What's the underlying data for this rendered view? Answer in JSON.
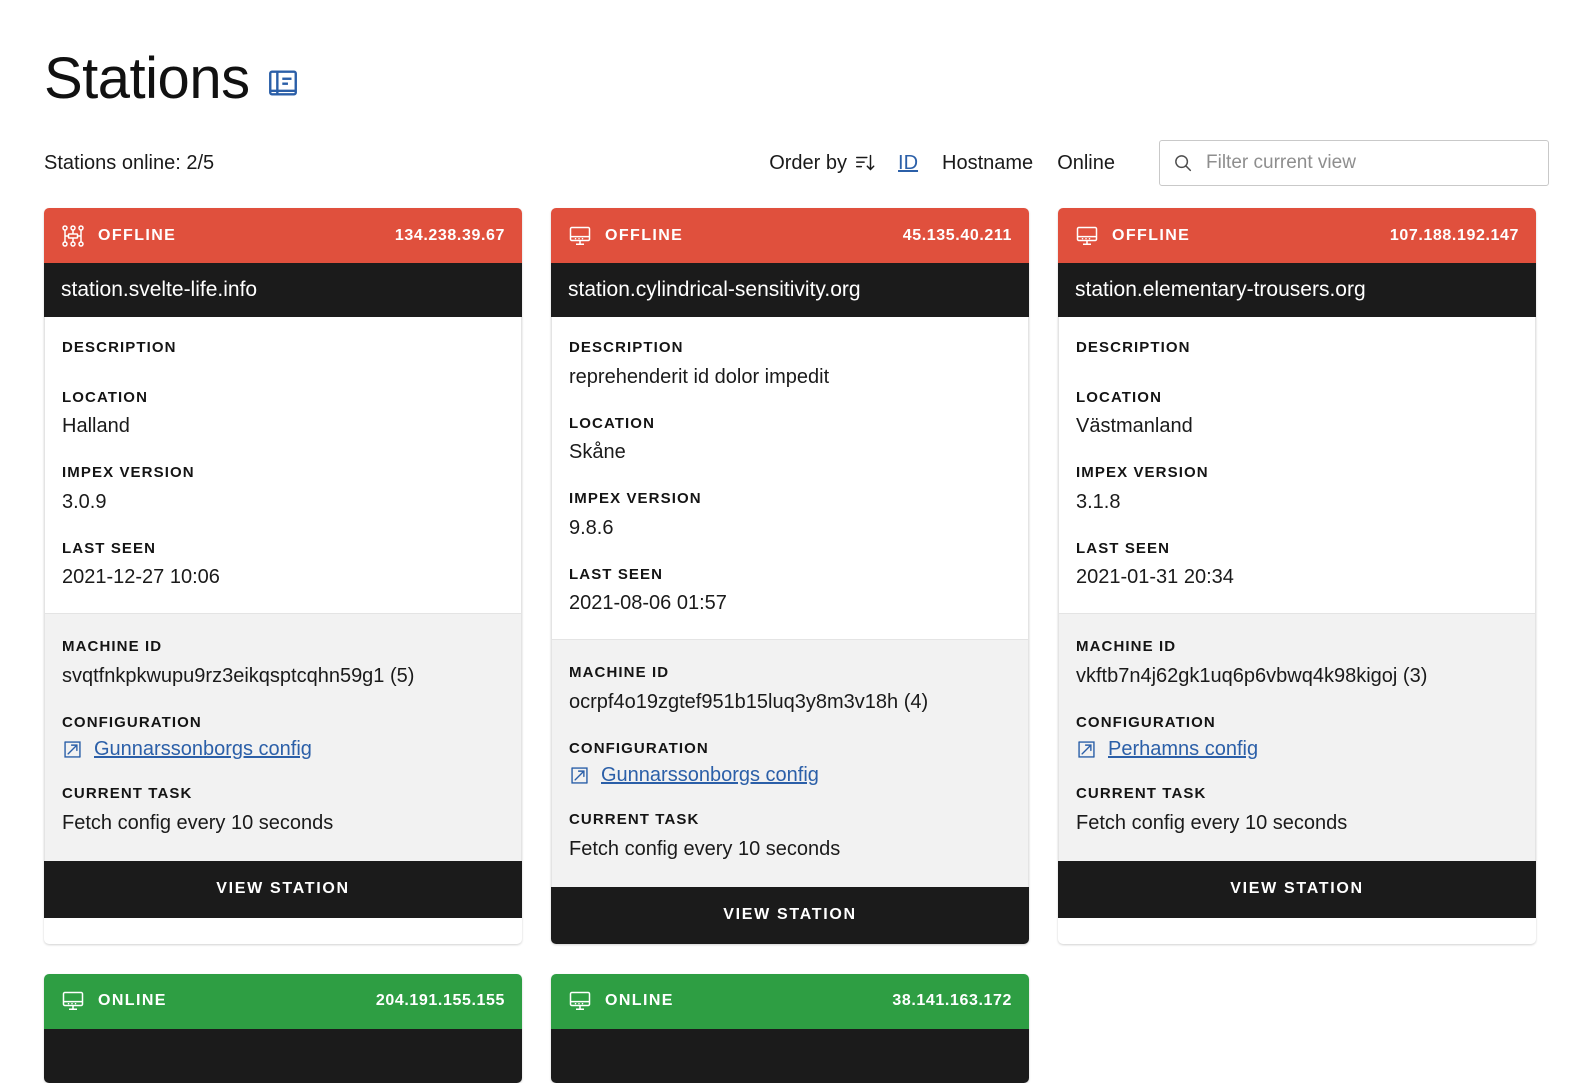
{
  "header": {
    "title": "Stations",
    "title_icon": "book-icon",
    "stations_online": "Stations online: 2/5"
  },
  "toolbar": {
    "order_by_label": "Order by",
    "sort_icon": "sort-descending-icon",
    "options": [
      {
        "label": "ID",
        "active": true
      },
      {
        "label": "Hostname",
        "active": false
      },
      {
        "label": "Online",
        "active": false
      }
    ],
    "filter": {
      "icon": "search-icon",
      "value": "",
      "placeholder": "Filter current view"
    }
  },
  "labels": {
    "description": "DESCRIPTION",
    "location": "LOCATION",
    "impex_version": "IMPEX VERSION",
    "last_seen": "LAST SEEN",
    "machine_id": "MACHINE ID",
    "configuration": "CONFIGURATION",
    "current_task": "CURRENT TASK",
    "view_station": "VIEW STATION"
  },
  "colors": {
    "offline": "#e0503d",
    "online": "#2e9e43",
    "dark": "#1b1b1b",
    "link": "#2b5fa8",
    "subpanel": "#f2f2f2"
  },
  "cards": [
    {
      "status": "OFFLINE",
      "status_state": "offline",
      "status_icon": "network-nodes-icon",
      "ip": "134.238.39.67",
      "hostname": "station.svelte-life.info",
      "description": "",
      "location": "Halland",
      "impex_version": "3.0.9",
      "last_seen": "2021-12-27 10:06",
      "machine_id": "svqtfnkpkwupu9rz3eikqsptcqhn59g1 (5)",
      "config_link": "Gunnarssonborgs config",
      "config_icon": "external-link-icon",
      "current_task": "Fetch config every 10 seconds",
      "view_station": "VIEW STATION"
    },
    {
      "status": "OFFLINE",
      "status_state": "offline",
      "status_icon": "monitor-icon",
      "ip": "45.135.40.211",
      "hostname": "station.cylindrical-sensitivity.org",
      "description": "reprehenderit id dolor impedit",
      "location": "Skåne",
      "impex_version": "9.8.6",
      "last_seen": "2021-08-06 01:57",
      "machine_id": "ocrpf4o19zgtef951b15luq3y8m3v18h (4)",
      "config_link": "Gunnarssonborgs config",
      "config_icon": "external-link-icon",
      "current_task": "Fetch config every 10 seconds",
      "view_station": "VIEW STATION"
    },
    {
      "status": "OFFLINE",
      "status_state": "offline",
      "status_icon": "monitor-icon",
      "ip": "107.188.192.147",
      "hostname": "station.elementary-trousers.org",
      "description": "",
      "location": "Västmanland",
      "impex_version": "3.1.8",
      "last_seen": "2021-01-31 20:34",
      "machine_id": "vkftb7n4j62gk1uq6p6vbwq4k98kigoj (3)",
      "config_link": "Perhamns config",
      "config_icon": "external-link-icon",
      "current_task": "Fetch config every 10 seconds",
      "view_station": "VIEW STATION"
    }
  ],
  "cards_partial": [
    {
      "status": "ONLINE",
      "status_state": "online",
      "status_icon": "monitor-icon",
      "ip": "204.191.155.155"
    },
    {
      "status": "ONLINE",
      "status_state": "online",
      "status_icon": "monitor-icon",
      "ip": "38.141.163.172"
    }
  ]
}
